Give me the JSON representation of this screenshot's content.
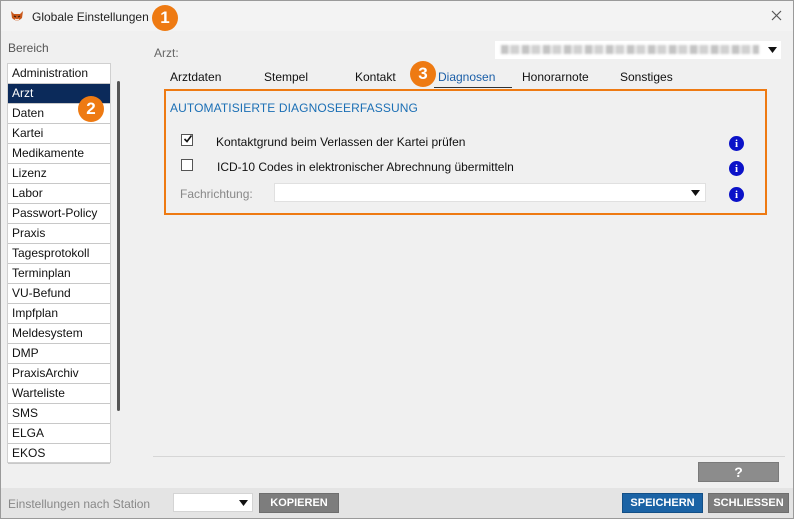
{
  "window": {
    "title": "Globale Einstellungen",
    "app_icon": "cat-logo-icon",
    "close_icon": "close-icon"
  },
  "markers": [
    "1",
    "2",
    "3"
  ],
  "sidebar": {
    "label": "Bereich",
    "selected": "Arzt",
    "items": [
      {
        "label": "Administration"
      },
      {
        "label": "Arzt"
      },
      {
        "label": "Daten"
      },
      {
        "label": "Kartei"
      },
      {
        "label": "Medikamente"
      },
      {
        "label": "Lizenz"
      },
      {
        "label": "Labor"
      },
      {
        "label": "Passwort-Policy"
      },
      {
        "label": "Praxis"
      },
      {
        "label": "Tagesprotokoll"
      },
      {
        "label": "Terminplan"
      },
      {
        "label": "VU-Befund"
      },
      {
        "label": "Impfplan"
      },
      {
        "label": "Meldesystem"
      },
      {
        "label": "DMP"
      },
      {
        "label": "PraxisArchiv"
      },
      {
        "label": "Warteliste"
      },
      {
        "label": "SMS"
      },
      {
        "label": "ELGA"
      },
      {
        "label": "EKOS"
      }
    ]
  },
  "arzt": {
    "label": "Arzt:"
  },
  "tabs": [
    {
      "label": "Arztdaten"
    },
    {
      "label": "Stempel"
    },
    {
      "label": "Kontakt"
    },
    {
      "label": "Diagnosen"
    },
    {
      "label": "Honorarnote"
    },
    {
      "label": "Sonstiges"
    }
  ],
  "active_tab": "Diagnosen",
  "panel": {
    "section_title": "AUTOMATISIERTE DIAGNOSEERFASSUNG",
    "options": [
      {
        "label": "Kontaktgrund beim Verlassen der Kartei prüfen",
        "checked": true
      },
      {
        "label": "ICD-10 Codes in elektronischer Abrechnung übermitteln",
        "checked": false
      }
    ],
    "fachrichtung_label": "Fachrichtung:",
    "fachrichtung_value": "",
    "info_glyph": "i"
  },
  "help_label": "?",
  "bottom": {
    "station_label": "Einstellungen nach Station",
    "station_value": "",
    "kopieren_label": "KOPIEREN",
    "speichern_label": "SPEICHERN",
    "schliessen_label": "SCHLIESSEN"
  },
  "colors": {
    "accent_orange": "#ee7a12",
    "selected_bg": "#0b2a5a",
    "section_blue": "#1b6fb5",
    "info_blue": "#0b12c8",
    "save_blue": "#1b63a5",
    "gray_button": "#7d7d7d"
  }
}
